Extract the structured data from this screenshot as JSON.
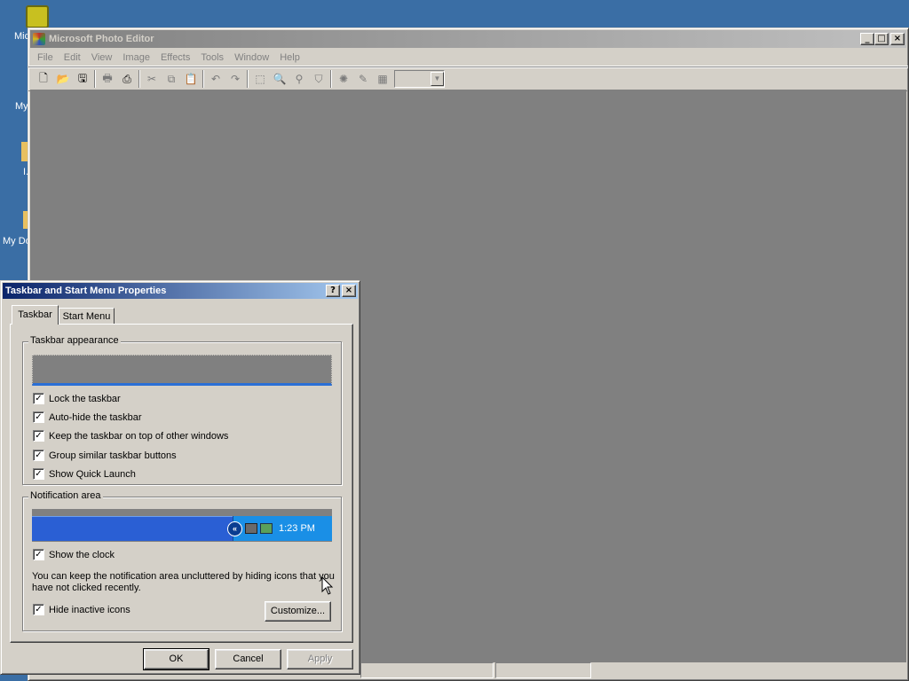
{
  "desktop": {
    "icons": [
      {
        "label": "Microsoft Outlook"
      },
      {
        "label": "My ..."
      },
      {
        "label": "I..."
      },
      {
        "label": "My Documents"
      }
    ]
  },
  "photo_editor": {
    "title": "Microsoft Photo Editor",
    "menus": [
      "File",
      "Edit",
      "View",
      "Image",
      "Effects",
      "Tools",
      "Window",
      "Help"
    ],
    "toolbar_icons": [
      "new-icon",
      "open-icon",
      "save-icon",
      "print-icon",
      "scan-icon",
      "cut-icon",
      "copy-icon",
      "paste-icon",
      "undo-icon",
      "redo-icon",
      "select-icon",
      "zoom-icon",
      "smudge-icon",
      "crop-icon",
      "effects-icon",
      "pen-icon",
      "grid-icon"
    ],
    "zoom_value": ""
  },
  "dialog": {
    "title": "Taskbar and Start Menu Properties",
    "tabs": [
      "Taskbar",
      "Start Menu"
    ],
    "appearance_group": "Taskbar appearance",
    "options": [
      {
        "label": "Lock the taskbar",
        "checked": true
      },
      {
        "label": "Auto-hide the taskbar",
        "checked": true
      },
      {
        "label": "Keep the taskbar on top of other windows",
        "checked": true
      },
      {
        "label": "Group similar taskbar buttons",
        "checked": true
      },
      {
        "label": "Show Quick Launch",
        "checked": true
      }
    ],
    "notification_group": "Notification area",
    "clock_time": "1:23 PM",
    "show_clock": "Show the clock",
    "hint": "You can keep the notification area uncluttered by hiding icons that you have not clicked recently.",
    "hide_inactive": "Hide inactive icons",
    "customize": "Customize...",
    "ok": "OK",
    "cancel": "Cancel",
    "apply": "Apply"
  }
}
